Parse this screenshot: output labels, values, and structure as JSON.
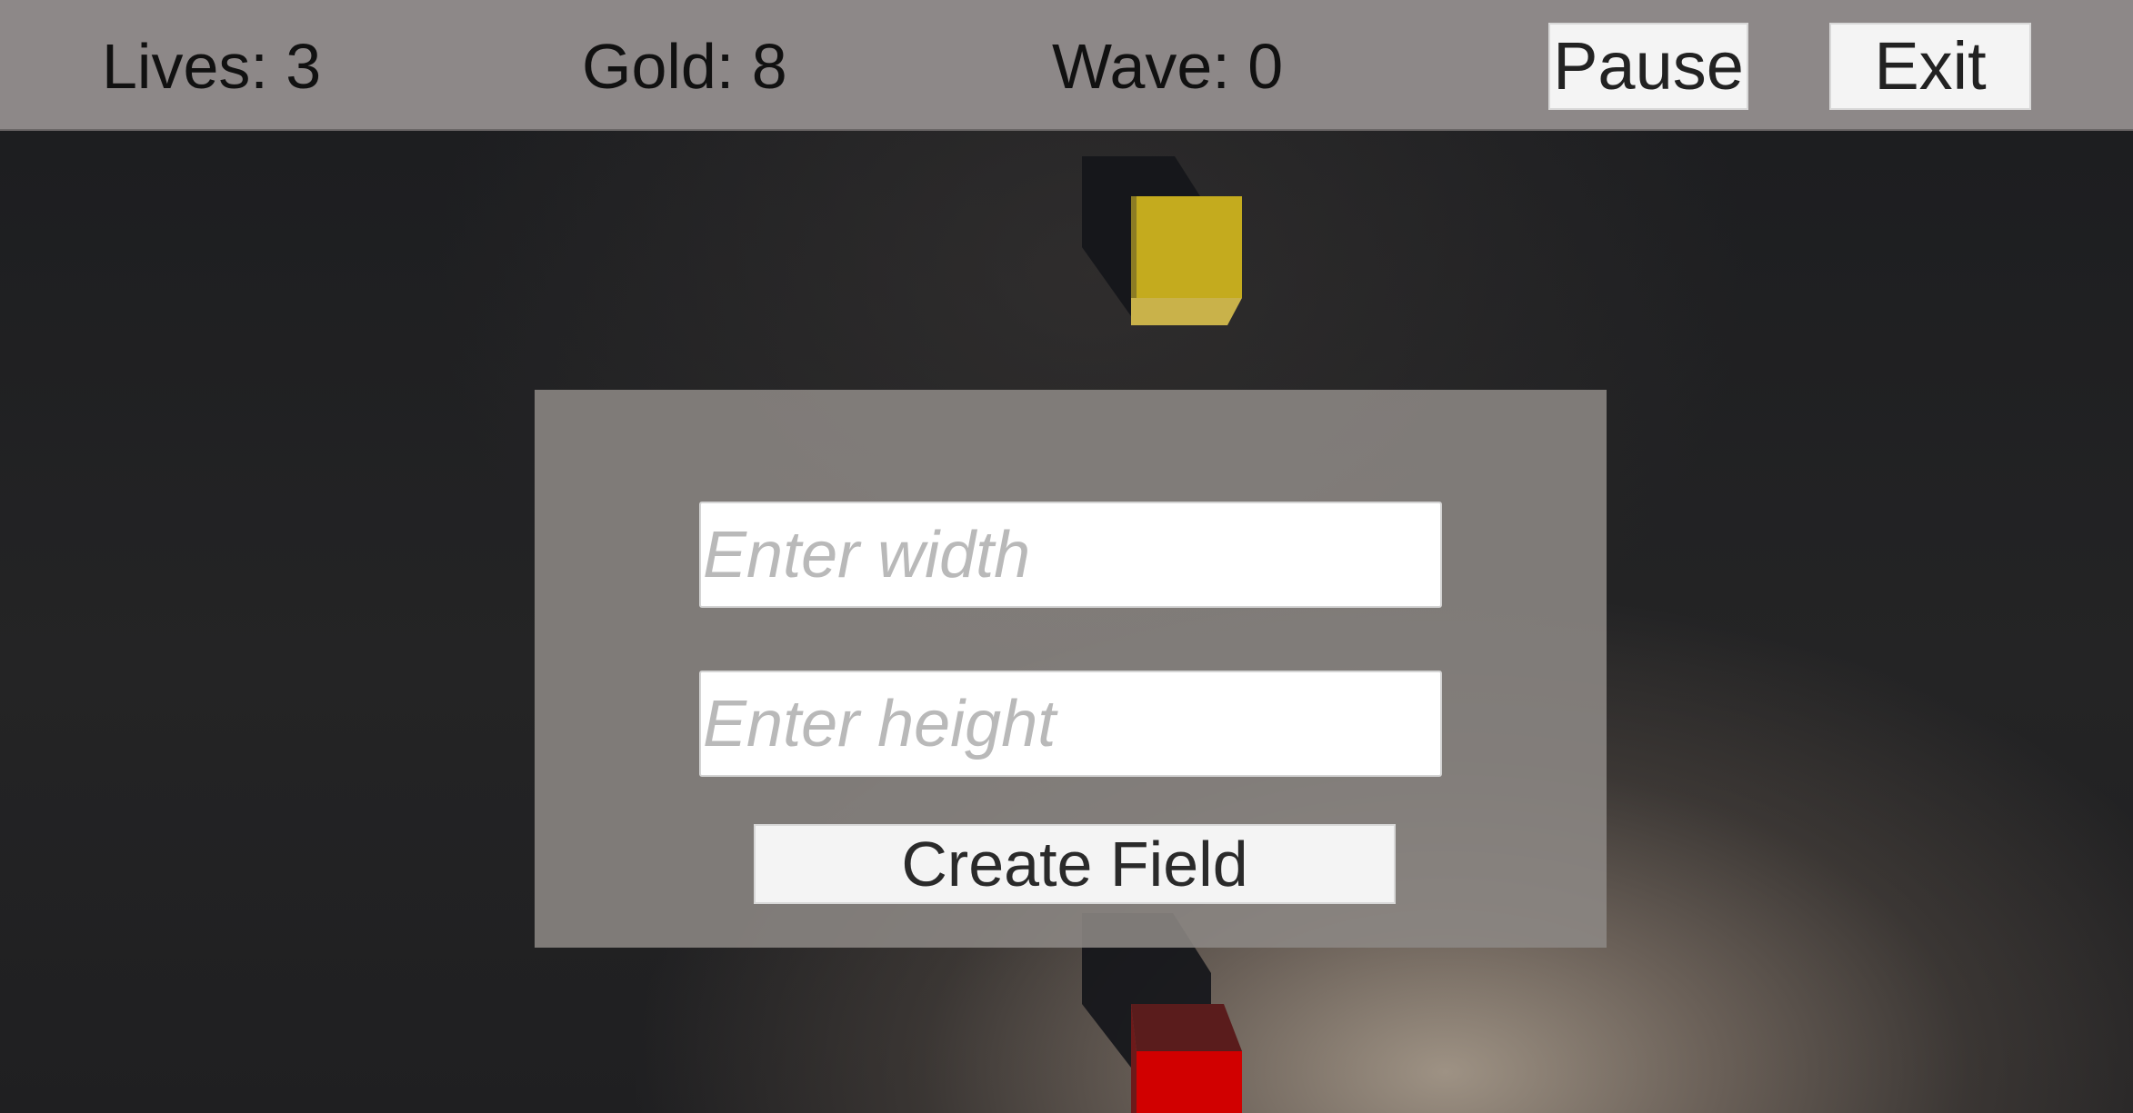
{
  "hud": {
    "lives_label": "Lives: 3",
    "gold_label": "Gold: 8",
    "wave_label": "Wave: 0",
    "pause_label": "Pause",
    "exit_label": "Exit"
  },
  "dialog": {
    "width_placeholder": "Enter width",
    "height_placeholder": "Enter height",
    "create_label": "Create Field"
  },
  "scene": {
    "cubes": [
      {
        "name": "yellow-cube",
        "color": "#c4ab1e"
      },
      {
        "name": "red-cube",
        "color": "#d10000"
      }
    ]
  }
}
